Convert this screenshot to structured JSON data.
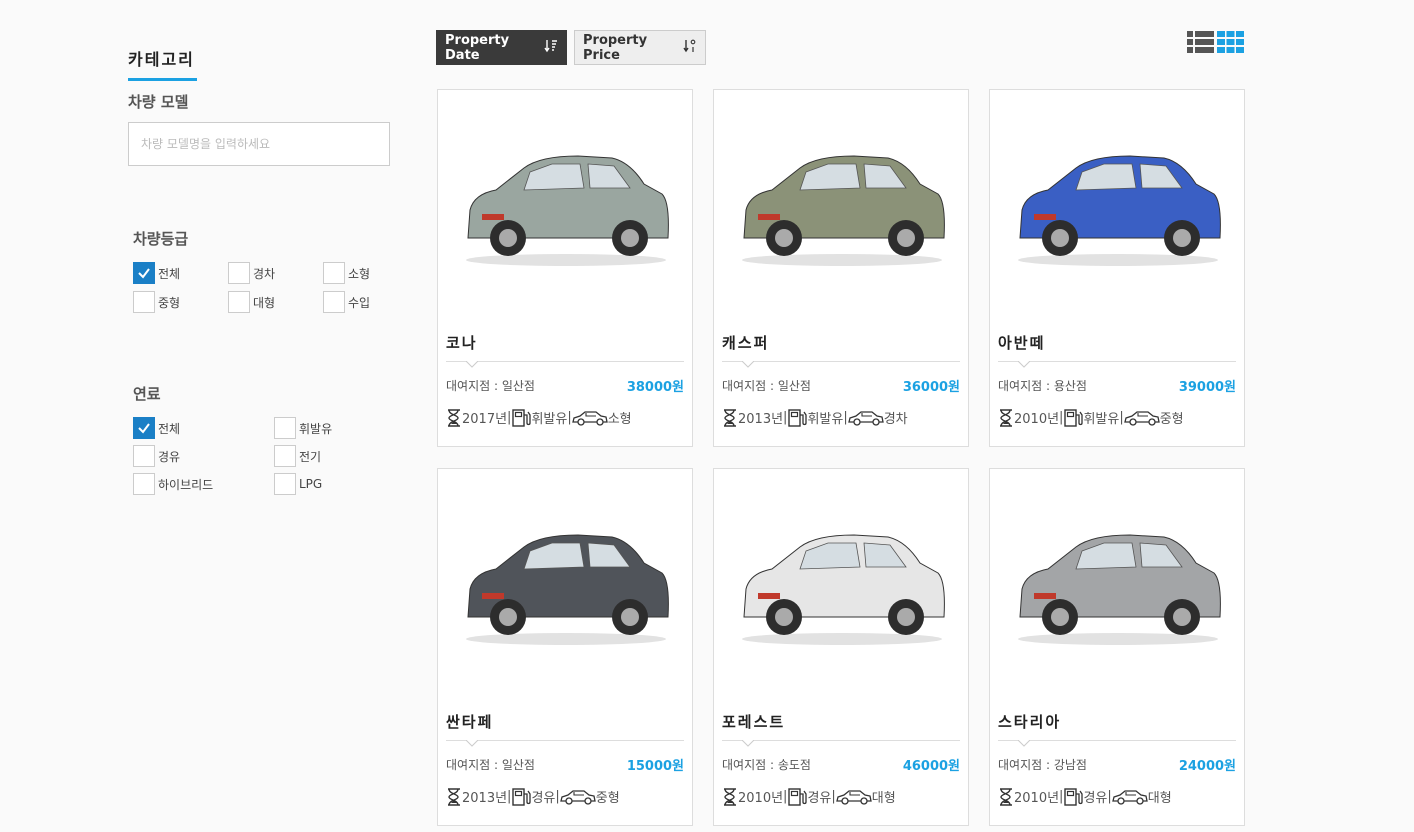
{
  "sidebar": {
    "category_title": "카테고리",
    "model_title": "차량 모델",
    "model_placeholder": "차량 모델명을 입력하세요",
    "grade_title": "차량등급",
    "grades": [
      {
        "label": "전체",
        "checked": true
      },
      {
        "label": "경차",
        "checked": false
      },
      {
        "label": "소형",
        "checked": false
      },
      {
        "label": "중형",
        "checked": false
      },
      {
        "label": "대형",
        "checked": false
      },
      {
        "label": "수입",
        "checked": false
      }
    ],
    "fuel_title": "연료",
    "fuels": [
      {
        "label": "전체",
        "checked": true
      },
      {
        "label": "휘발유",
        "checked": false
      },
      {
        "label": "경유",
        "checked": false
      },
      {
        "label": "전기",
        "checked": false
      },
      {
        "label": "하이브리드",
        "checked": false
      },
      {
        "label": "LPG",
        "checked": false
      }
    ]
  },
  "toolbar": {
    "sort_date": "Property Date",
    "sort_price": "Property Price",
    "view_list_icon": "list-view-icon",
    "view_grid_icon": "grid-view-icon",
    "active_view_color": "#1ba1e2"
  },
  "cars": [
    {
      "name": "코나",
      "branch": "대여지점 : 일산점",
      "price": "38000원",
      "year": "2017년",
      "fuel": "휘발유",
      "size": "소형",
      "color": "#9aa6a0"
    },
    {
      "name": "캐스퍼",
      "branch": "대여지점 : 일산점",
      "price": "36000원",
      "year": "2013년",
      "fuel": "휘발유",
      "size": "경차",
      "color": "#8b9278"
    },
    {
      "name": "아반떼",
      "branch": "대여지점 : 용산점",
      "price": "39000원",
      "year": "2010년",
      "fuel": "휘발유",
      "size": "중형",
      "color": "#3a5fc4"
    },
    {
      "name": "싼타페",
      "branch": "대여지점 : 일산점",
      "price": "15000원",
      "year": "2013년",
      "fuel": "경유",
      "size": "중형",
      "color": "#50545a"
    },
    {
      "name": "포레스트",
      "branch": "대여지점 : 송도점",
      "price": "46000원",
      "year": "2010년",
      "fuel": "경유",
      "size": "대형",
      "color": "#e6e6e6"
    },
    {
      "name": "스타리아",
      "branch": "대여지점 : 강남점",
      "price": "24000원",
      "year": "2010년",
      "fuel": "경유",
      "size": "대형",
      "color": "#a3a5a7"
    }
  ]
}
